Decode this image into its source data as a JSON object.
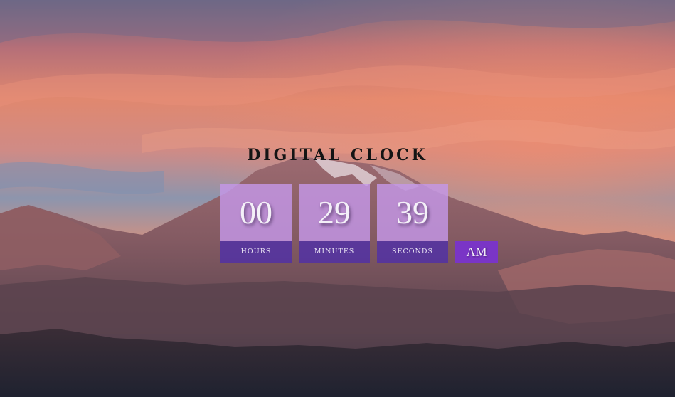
{
  "app": {
    "title": "DIGITAL CLOCK"
  },
  "clock": {
    "hours": "00",
    "minutes": "29",
    "seconds": "39",
    "hours_label": "HOURS",
    "minutes_label": "MINUTES",
    "seconds_label": "SECONDS",
    "period": "AM"
  },
  "colors": {
    "digit_box": "#c497e8",
    "label_box": "#4e2eaa",
    "period_box": "#7a35c6",
    "title_text": "#141414"
  },
  "background": {
    "description_icon": "mountain-sunset-image"
  }
}
